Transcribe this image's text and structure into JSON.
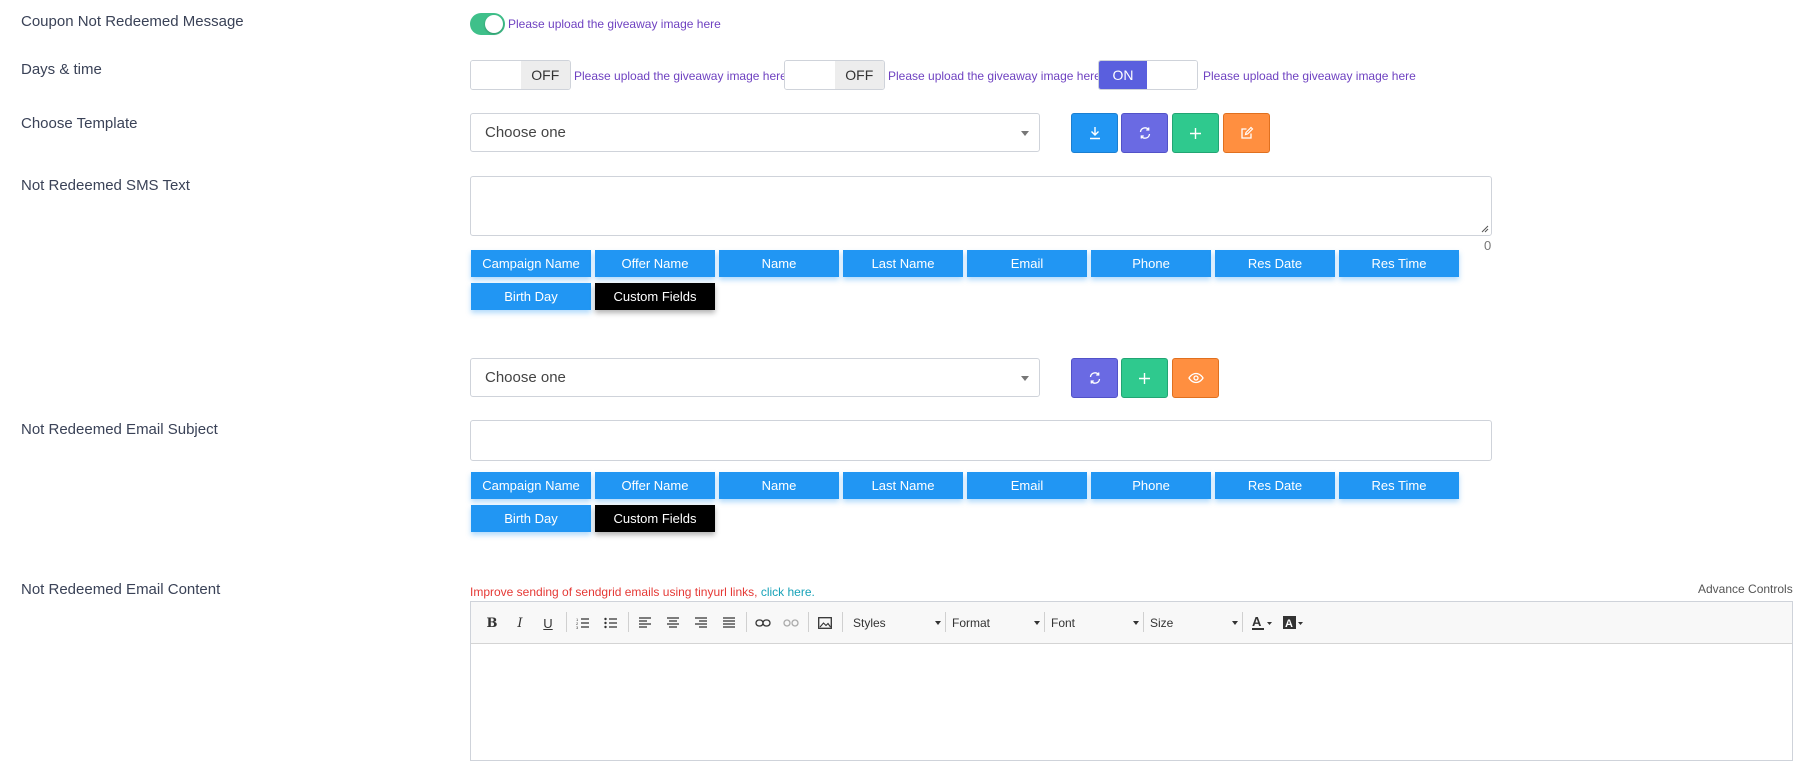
{
  "labels": {
    "coupon_not_redeemed": "Coupon Not Redeemed Message",
    "days_time": "Days & time",
    "choose_template": "Choose Template",
    "sms_text": "Not Redeemed SMS Text",
    "email_subject": "Not Redeemed Email Subject",
    "email_content": "Not Redeemed Email Content"
  },
  "hint": "Please upload the giveaway image here",
  "switches": {
    "off_label": "OFF",
    "on_label": "ON"
  },
  "selects": {
    "template_placeholder": "Choose one",
    "email_template_placeholder": "Choose one"
  },
  "sms_counter": "0",
  "tags": {
    "campaign_name": "Campaign Name",
    "offer_name": "Offer Name",
    "name": "Name",
    "last_name": "Last Name",
    "email": "Email",
    "phone": "Phone",
    "res_date": "Res Date",
    "res_time": "Res Time",
    "birth_day": "Birth Day",
    "custom_fields": "Custom Fields"
  },
  "email_notice": {
    "text": "Improve sending of sendgrid emails using tinyurl links,",
    "link": "click here."
  },
  "advance_controls": "Advance Controls",
  "editor_toolbar": {
    "styles": "Styles",
    "format": "Format",
    "font": "Font",
    "size": "Size"
  },
  "icons": {
    "download": "download-icon",
    "refresh": "refresh-icon",
    "add": "plus-icon",
    "edit": "edit-icon",
    "preview": "eye-icon"
  },
  "colors": {
    "toggle_on": "#3fc08a",
    "hint": "#6f42c1",
    "tag_blue": "#2196f3",
    "switch_on": "#5a5fde",
    "warn": "#e53935",
    "link": "#17a2b8"
  }
}
